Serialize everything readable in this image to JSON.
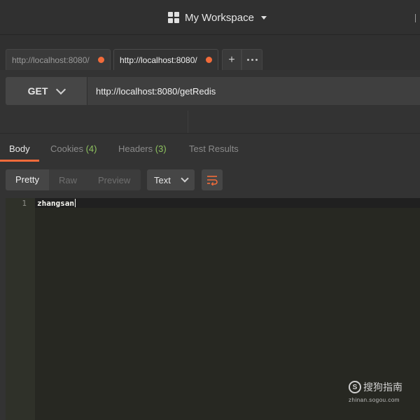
{
  "header": {
    "workspace_label": "My Workspace",
    "icons": [
      "grid-icon",
      "caret-down-icon"
    ]
  },
  "tabs": {
    "items": [
      {
        "label": "http://localhost:8080/",
        "unsaved": true,
        "active": false
      },
      {
        "label": "http://localhost:8080/",
        "unsaved": true,
        "active": true
      }
    ],
    "add_label": "+",
    "more_icon": "ellipsis-icon"
  },
  "request": {
    "method": "GET",
    "url": "http://localhost:8080/getRedis"
  },
  "response_tabs": {
    "body": "Body",
    "cookies": "Cookies",
    "cookies_count": "(4)",
    "headers": "Headers",
    "headers_count": "(3)",
    "test_results": "Test Results"
  },
  "toolbar": {
    "pretty": "Pretty",
    "raw": "Raw",
    "preview": "Preview",
    "format": "Text",
    "wrap_icon": "wrap-lines-icon"
  },
  "editor": {
    "lines": [
      {
        "number": "1",
        "text": "zhangsan"
      }
    ]
  },
  "watermark": {
    "brand": "搜狗指南",
    "site": "zhinan.sogou.com",
    "logo_letter": "S"
  },
  "colors": {
    "accent": "#f26b3a",
    "count_green": "#8ec25f",
    "editor_bg": "#272822"
  }
}
